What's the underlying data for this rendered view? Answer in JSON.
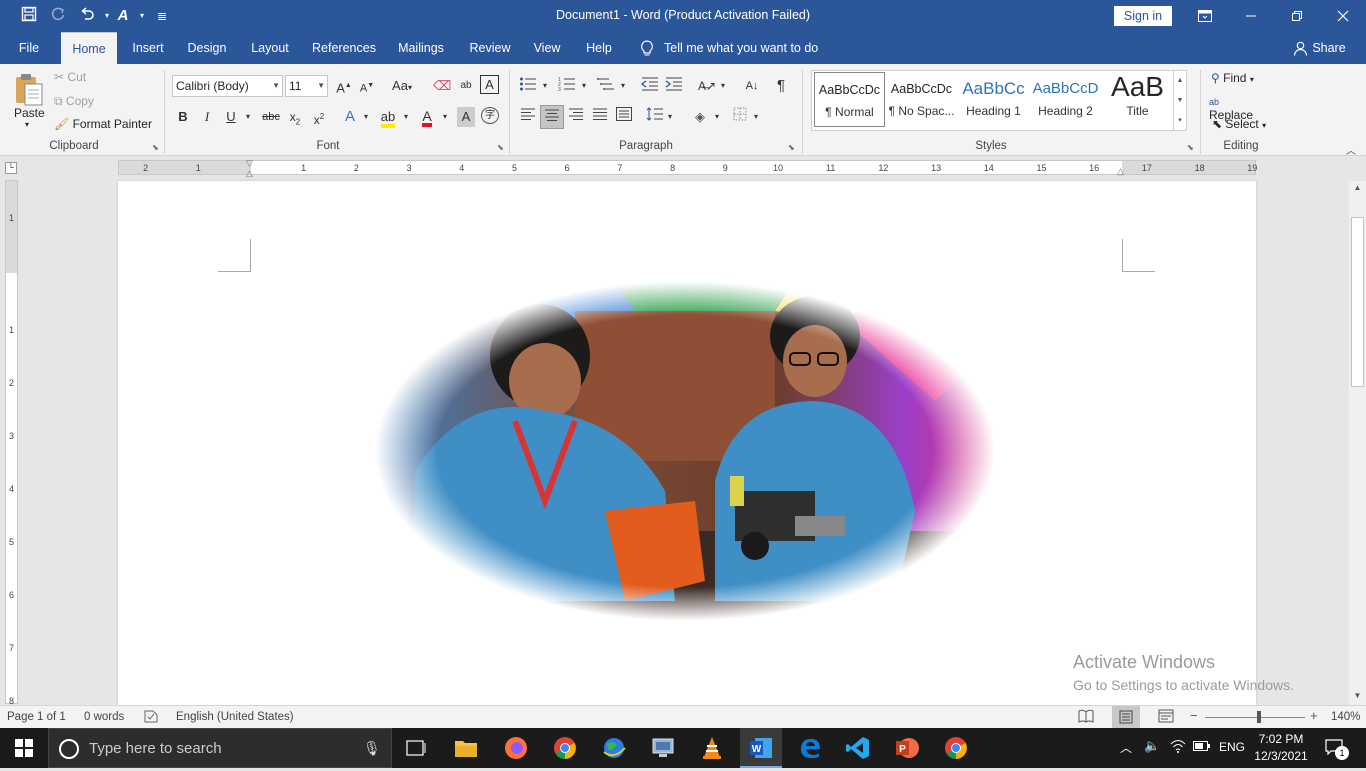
{
  "titlebar": {
    "title": "Document1  -  Word (Product Activation Failed)",
    "sign_in": "Sign in",
    "qat_more": "≣"
  },
  "tabs": [
    "File",
    "Home",
    "Insert",
    "Design",
    "Layout",
    "References",
    "Mailings",
    "Review",
    "View",
    "Help"
  ],
  "tell_me": "Tell me what you want to do",
  "share": "Share",
  "clipboard": {
    "paste": "Paste",
    "cut": "Cut",
    "copy": "Copy",
    "format_painter": "Format Painter",
    "group": "Clipboard"
  },
  "font": {
    "name": "Calibri (Body)",
    "size": "11",
    "group": "Font"
  },
  "paragraph": {
    "group": "Paragraph"
  },
  "styles": {
    "group": "Styles",
    "items": [
      {
        "preview": "AaBbCcDc",
        "name": "¶ Normal"
      },
      {
        "preview": "AaBbCcDc",
        "name": "¶ No Spac..."
      },
      {
        "preview": "AaBbCc",
        "name": "Heading 1"
      },
      {
        "preview": "AaBbCcD",
        "name": "Heading 2"
      },
      {
        "preview": "AaB",
        "name": "Title"
      }
    ]
  },
  "editing": {
    "find": "Find",
    "replace": "Replace",
    "select": "Select",
    "group": "Editing"
  },
  "ruler": {
    "h_left": [
      "2",
      "1"
    ],
    "h_right": [
      "1",
      "2",
      "3",
      "4",
      "5",
      "6",
      "7",
      "8",
      "9",
      "10",
      "11",
      "12",
      "13",
      "14",
      "15",
      "16",
      "17",
      "18",
      "19"
    ],
    "v_labels": [
      "1",
      "1",
      "2",
      "3",
      "4",
      "5",
      "6",
      "7",
      "8"
    ]
  },
  "watermark": {
    "line1": "Activate Windows",
    "line2": "Go to Settings to activate Windows."
  },
  "status": {
    "page": "Page 1 of 1",
    "words": "0 words",
    "language": "English (United States)",
    "zoom": "140%"
  },
  "taskbar": {
    "search_placeholder": "Type here to search",
    "lang": "ENG",
    "time": "7:02 PM",
    "date": "12/3/2021",
    "notifications": "1"
  }
}
